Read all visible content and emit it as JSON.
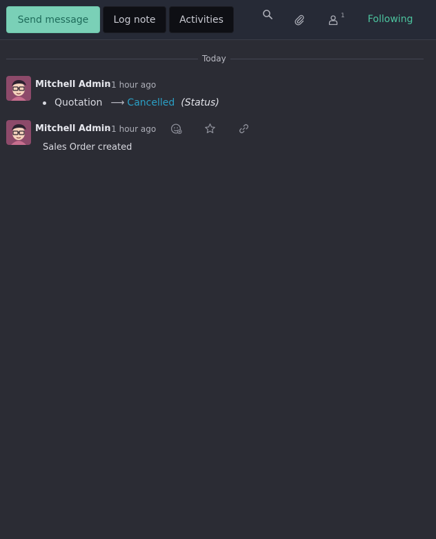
{
  "composer": {
    "send_message_label": "Send message",
    "log_note_label": "Log note",
    "activities_label": "Activities",
    "followers_count": "1",
    "following_label": "Following"
  },
  "thread": {
    "date_separator": "Today",
    "messages": [
      {
        "author": "Mitchell Admin",
        "date": "- 1 hour ago",
        "tracking": {
          "old_value": "Quotation",
          "arrow": "⟶",
          "new_value": "Cancelled",
          "field": "(Status)"
        }
      },
      {
        "author": "Mitchell Admin",
        "date": "- 1 hour ago",
        "body": "Sales Order created"
      }
    ]
  },
  "icons": {
    "search": "search-icon",
    "attachment": "paperclip-icon",
    "followers": "user-icon",
    "reaction": "add-reaction-icon",
    "star": "star-icon",
    "link": "link-icon"
  },
  "colors": {
    "primary_button": "#7ad0b7",
    "following": "#4cc49f",
    "new_value": "#2aa0c6"
  }
}
